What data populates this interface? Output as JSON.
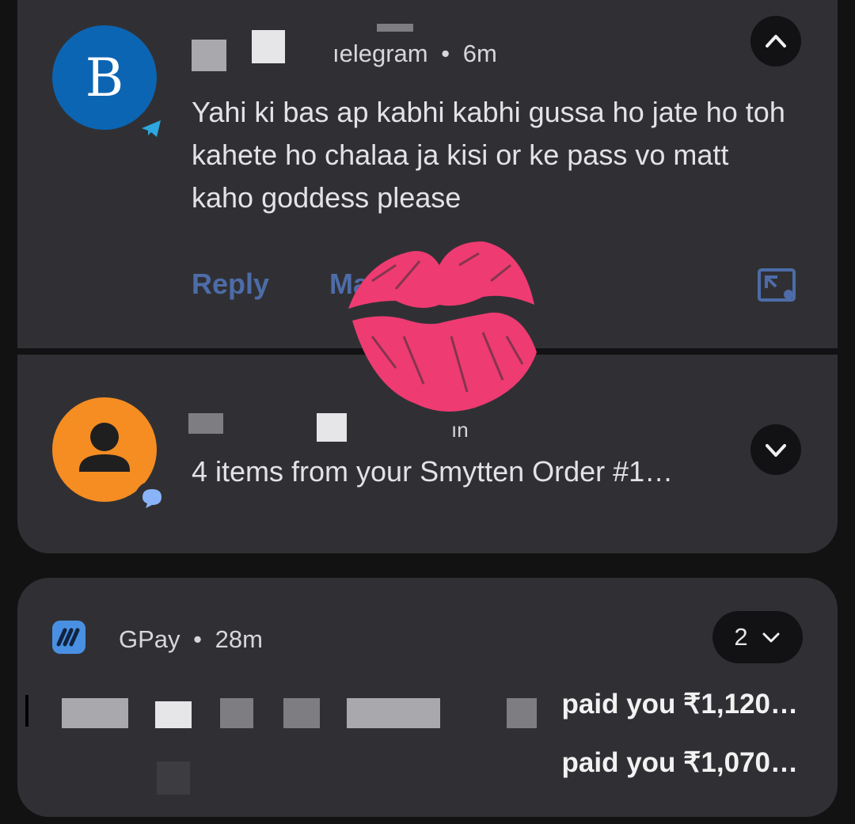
{
  "telegram_notification": {
    "app_name": "ıelegram",
    "separator": "•",
    "time": "6m",
    "avatar_letter": "B",
    "message": "Yahi ki bas ap kabhi kabhi gussa ho jate ho toh kahete ho chalaa ja kisi or ke pass vo matt kaho goddess please",
    "actions": {
      "reply": "Reply",
      "mark_read_partial": "Ma"
    },
    "accent_color": "#0b65b3",
    "icons": [
      "telegram-badge-icon",
      "collapse-chevron-icon",
      "open-in-window-icon"
    ]
  },
  "messages_notification": {
    "meta_partial": "ın",
    "message": "4 items from your Smytten Order #1…",
    "accent_color": "#f58d22",
    "icons": [
      "person-icon",
      "messages-badge-icon",
      "expand-chevron-icon"
    ]
  },
  "gpay_notification": {
    "app_name": "GPay",
    "separator": "•",
    "time": "28m",
    "count": "2",
    "rows": [
      {
        "text": "paid you ₹1,120…"
      },
      {
        "text": "paid you ₹1,070…"
      }
    ],
    "icons": [
      "gpay-logo-icon",
      "expand-chevron-icon"
    ]
  },
  "overlay": {
    "icon": "kiss-mark-icon",
    "color": "#ee3b72"
  }
}
